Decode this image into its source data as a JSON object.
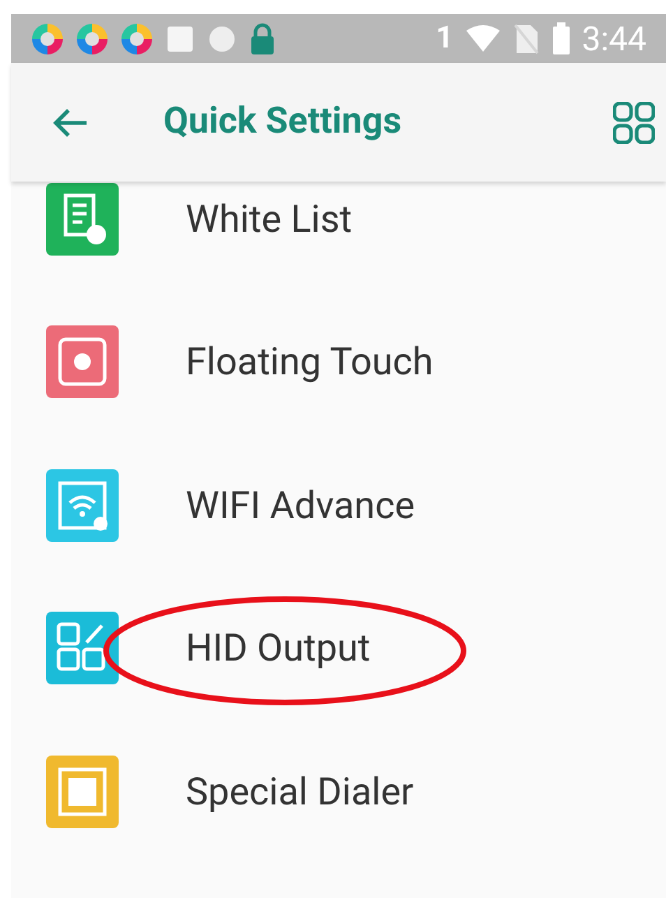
{
  "status_bar": {
    "notification_count": "1",
    "time": "3:44"
  },
  "app_bar": {
    "title": "Quick Settings"
  },
  "items": [
    {
      "label": "White List",
      "color": "#1fb25a",
      "kind": "list"
    },
    {
      "label": "Floating Touch",
      "color": "#ec6b78",
      "kind": "touch"
    },
    {
      "label": "WIFI Advance",
      "color": "#2cc6e4",
      "kind": "wifi"
    },
    {
      "label": "HID Output",
      "color": "#1bbcd8",
      "kind": "hid",
      "highlighted": true
    },
    {
      "label": "Special Dialer",
      "color": "#f0b92e",
      "kind": "dialer"
    }
  ]
}
